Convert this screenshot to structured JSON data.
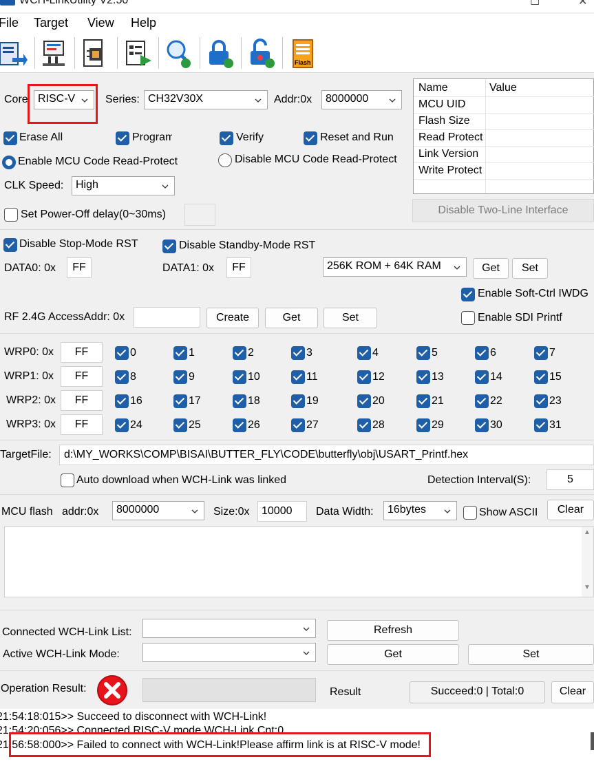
{
  "window": {
    "title": "WCH-LinkUtility V2.50"
  },
  "menu": [
    "File",
    "Target",
    "View",
    "Help"
  ],
  "toolbar_icons": [
    "connect-icon",
    "settings-icon",
    "chip-query-icon",
    "program-icon",
    "search-target-icon",
    "lock-icon",
    "unlock-icon",
    "flash-file-icon"
  ],
  "toolbar_flash_label": "Flash",
  "core": {
    "label": "Core",
    "value": "RISC-V"
  },
  "series": {
    "label": "Series:",
    "value": "CH32V30X"
  },
  "addr": {
    "label": "Addr:0x",
    "value": "8000000"
  },
  "options": {
    "erase_all": "Erase All",
    "program": "Program",
    "verify": "Verify",
    "reset_run": "Reset and Run",
    "enable_protect": "Enable MCU Code Read-Protect",
    "disable_protect": "Disable MCU Code Read-Protect",
    "clk_label": "CLK Speed:",
    "clk_value": "High",
    "power_off": "Set Power-Off delay(0~30ms)"
  },
  "info_table": {
    "col_name": "Name",
    "col_value": "Value",
    "rows": [
      "MCU UID",
      "Flash Size",
      "Read Protect",
      "Link Version",
      "Write Protect"
    ]
  },
  "disable_two_line": "Disable Two-Line Interface",
  "rst": {
    "stop_mode": "Disable Stop-Mode RST",
    "standby_mode": "Disable Standby-Mode RST",
    "data0_label": "DATA0: 0x",
    "data0_value": "FF",
    "data1_label": "DATA1: 0x",
    "data1_value": "FF",
    "memory_value": "256K ROM +  64K RAM",
    "get": "Get",
    "set": "Set",
    "soft_iwdg": "Enable Soft-Ctrl IWDG",
    "sdi_printf": "Enable SDI Printf"
  },
  "rf": {
    "label": "RF 2.4G AccessAddr: 0x",
    "value": "",
    "create": "Create",
    "get": "Get",
    "set": "Set"
  },
  "wrp": [
    {
      "label": "WRP0: 0x",
      "value": "FF",
      "bits": [
        "0",
        "1",
        "2",
        "3",
        "4",
        "5",
        "6",
        "7"
      ]
    },
    {
      "label": "WRP1: 0x",
      "value": "FF",
      "bits": [
        "8",
        "9",
        "10",
        "11",
        "12",
        "13",
        "14",
        "15"
      ]
    },
    {
      "label": "WRP2: 0x",
      "value": "FF",
      "bits": [
        "16",
        "17",
        "18",
        "19",
        "20",
        "21",
        "22",
        "23"
      ]
    },
    {
      "label": "WRP3: 0x",
      "value": "FF",
      "bits": [
        "24",
        "25",
        "26",
        "27",
        "28",
        "29",
        "30",
        "31"
      ]
    }
  ],
  "target_file": {
    "label": "TargetFile:",
    "path": "d:\\MY_WORKS\\COMP\\BISAI\\BUTTER_FLY\\CODE\\butterfly\\obj\\USART_Printf.hex",
    "auto_download": "Auto download when WCH-Link was linked",
    "interval_label": "Detection Interval(S):",
    "interval_value": "5"
  },
  "mcu_flash": {
    "label": "MCU flash",
    "addr_label": "addr:0x",
    "addr_value": "8000000",
    "size_label": "Size:0x",
    "size_value": "10000",
    "width_label": "Data Width:",
    "width_value": "16bytes",
    "show_ascii": "Show ASCII",
    "clear": "Clear"
  },
  "link": {
    "list_label": "Connected WCH-Link List:",
    "refresh": "Refresh",
    "mode_label": "Active WCH-Link  Mode:",
    "get": "Get",
    "set": "Set"
  },
  "operation": {
    "label": "Operation Result:",
    "result_label": "Result",
    "summary": "Succeed:0 | Total:0",
    "clear": "Clear",
    "error_color": "#e8141c"
  },
  "log": [
    "21:54:18:015>> Succeed to disconnect with WCH-Link!",
    "21:54:20:056>> Connected RISC-V mode WCH-Link Cnt:0",
    "21:56:58:000>> Failed to connect with WCH-Link!Please affirm link is at RISC-V mode!"
  ]
}
